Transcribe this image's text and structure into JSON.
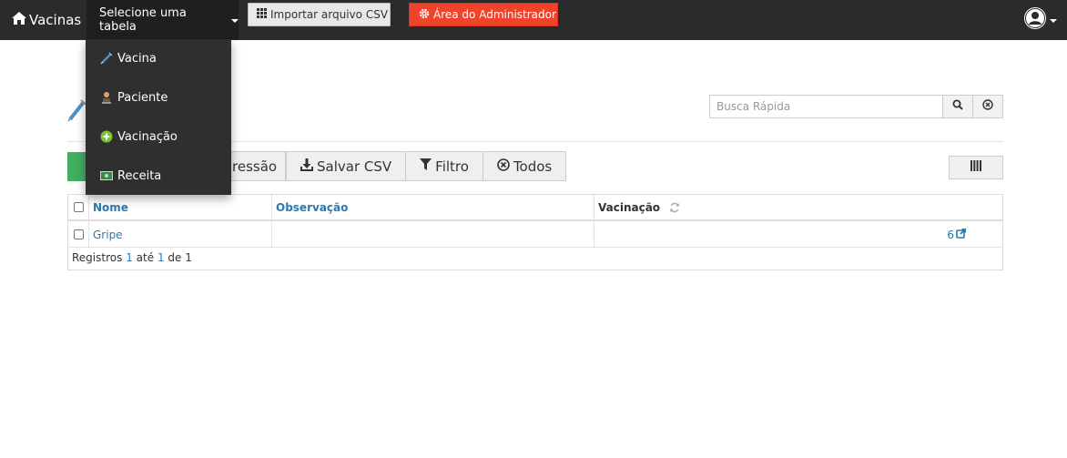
{
  "navbar": {
    "brand": "Vacinas",
    "table_select": "Selecione uma tabela",
    "import_csv": "Importar arquivo CSV",
    "admin_area": "Área do Administrador"
  },
  "dropdown": {
    "items": [
      {
        "label": "Vacina",
        "icon": "syringe-icon"
      },
      {
        "label": "Paciente",
        "icon": "person-icon"
      },
      {
        "label": "Vacinação",
        "icon": "plus-circle-icon"
      },
      {
        "label": "Receita",
        "icon": "money-icon"
      }
    ]
  },
  "search": {
    "placeholder": "Busca Rápida"
  },
  "toolbar": {
    "print_partial": "ressão",
    "save_csv": "Salvar CSV",
    "filter": "Filtro",
    "all": "Todos"
  },
  "table": {
    "columns": [
      "Nome",
      "Observação",
      "Vacinação"
    ],
    "rows": [
      {
        "nome": "Gripe",
        "observacao": "",
        "vacinacao": "6"
      }
    ]
  },
  "pagination": {
    "prefix": "Registros",
    "from": "1",
    "sep1": "até",
    "to": "1",
    "sep2": "de",
    "total": "1"
  },
  "colors": {
    "navbar": "#2b2b2b",
    "admin": "#f0432b",
    "new_button": "#3fae5f",
    "link": "#2a7ab0"
  }
}
